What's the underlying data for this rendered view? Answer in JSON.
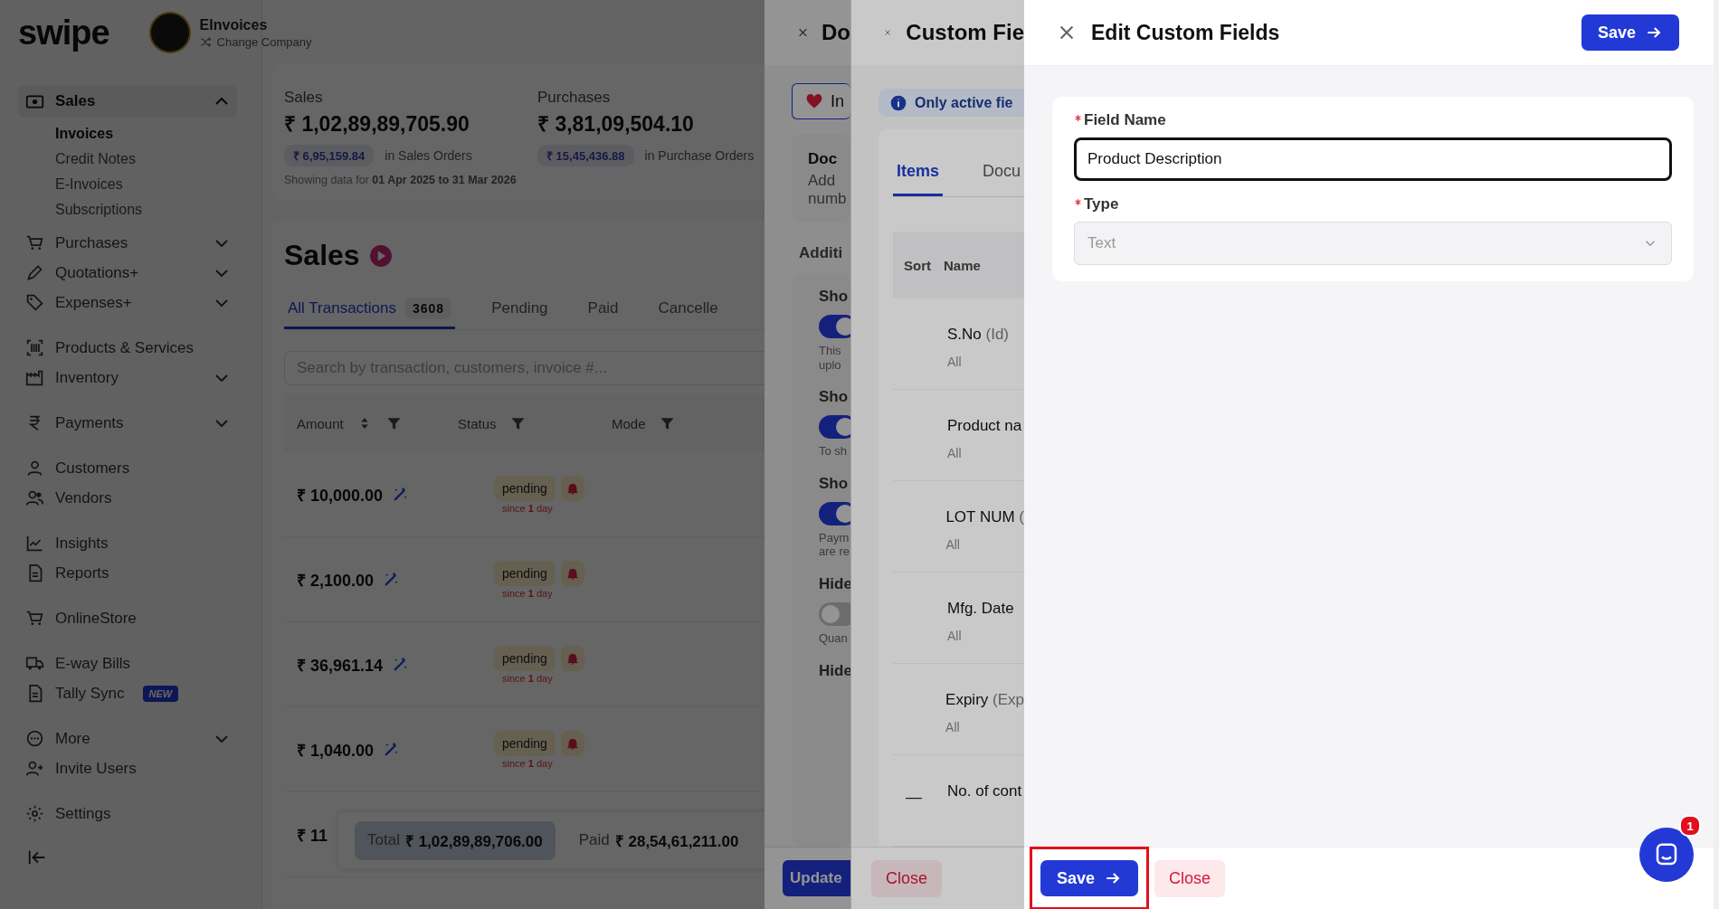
{
  "sidebar": {
    "logo": "swipe",
    "company": {
      "name": "EInvoices",
      "action": "Change Company"
    },
    "sections": [
      {
        "items": [
          {
            "label": "Sales",
            "kind": "group",
            "selected": true,
            "expanded": true,
            "children": [
              {
                "label": "Invoices",
                "selected": true
              },
              {
                "label": "Credit Notes",
                "selected": false
              },
              {
                "label": "E-Invoices",
                "selected": false
              },
              {
                "label": "Subscriptions",
                "selected": false
              }
            ]
          },
          {
            "label": "Purchases",
            "kind": "group",
            "expanded": false
          },
          {
            "label": "Quotations+",
            "kind": "group",
            "expanded": false
          },
          {
            "label": "Expenses+",
            "kind": "group",
            "expanded": false
          }
        ]
      },
      {
        "items": [
          {
            "label": "Products & Services",
            "kind": "link"
          },
          {
            "label": "Inventory",
            "kind": "group",
            "expanded": false
          }
        ]
      },
      {
        "items": [
          {
            "label": "Payments",
            "kind": "group",
            "expanded": false
          }
        ]
      },
      {
        "items": [
          {
            "label": "Customers",
            "kind": "link"
          },
          {
            "label": "Vendors",
            "kind": "link"
          }
        ]
      },
      {
        "items": [
          {
            "label": "Insights",
            "kind": "link"
          },
          {
            "label": "Reports",
            "kind": "link"
          }
        ]
      },
      {
        "items": [
          {
            "label": "OnlineStore",
            "kind": "link"
          }
        ]
      },
      {
        "items": [
          {
            "label": "E-way Bills",
            "kind": "link"
          },
          {
            "label": "Tally Sync",
            "kind": "link",
            "badge": "NEW"
          }
        ]
      },
      {
        "items": [
          {
            "label": "More",
            "kind": "group",
            "expanded": false
          },
          {
            "label": "Invite Users",
            "kind": "link"
          }
        ]
      },
      {
        "items": [
          {
            "label": "Settings",
            "kind": "link"
          }
        ]
      }
    ]
  },
  "sales_page": {
    "stats": [
      {
        "label": "Sales",
        "amount": "₹ 1,02,89,89,705.90",
        "order_amount": "₹ 6,95,159.84",
        "order_label": "in Sales Orders"
      },
      {
        "label": "Purchases",
        "amount": "₹ 3,81,09,504.10",
        "order_amount": "₹ 15,45,436.88",
        "order_label": "in Purchase Orders"
      }
    ],
    "range_note": "Showing data for **01 Apr 2025 to 31 Mar 2026**",
    "title": "Sales",
    "tabs": [
      {
        "label": "All Transactions",
        "count": "3608",
        "selected": true
      },
      {
        "label": "Pending",
        "selected": false
      },
      {
        "label": "Paid",
        "selected": false
      },
      {
        "label": "Cancelle",
        "selected": false
      }
    ],
    "search": {
      "placeholder": "Search by transaction, customers, invoice #..."
    },
    "columns": [
      {
        "label": "Amount",
        "sortable": true
      },
      {
        "label": "Status",
        "sortable": false
      },
      {
        "label": "Mode",
        "sortable": false
      }
    ],
    "rows": [
      {
        "amount": "₹ 10,000.00",
        "status": "pending",
        "since": "since **1** day"
      },
      {
        "amount": "₹ 2,100.00",
        "status": "pending",
        "since": "since **1** day"
      },
      {
        "amount": "₹ 36,961.14",
        "status": "pending",
        "since": "since **1** day"
      },
      {
        "amount": "₹ 1,040.00",
        "status": "pending",
        "since": "since **1** day"
      },
      {
        "amount": "₹ 11"
      }
    ],
    "totals": [
      {
        "label": "Total",
        "value": "₹ 1,02,89,89,706.00",
        "selected": true
      },
      {
        "label": "Paid",
        "value": "₹ 28,54,61,211.00",
        "selected": false
      }
    ]
  },
  "document_drawer": {
    "title": "Do",
    "top_button": "In",
    "card": {
      "title": "Doc",
      "lines": [
        "Add",
        "numb"
      ]
    },
    "section": "Additi",
    "settings": [
      {
        "label": "Sho",
        "on": true,
        "note": [
          "This",
          "uplo"
        ]
      },
      {
        "label": "Sho",
        "on": true,
        "note": [
          "To sh"
        ]
      },
      {
        "label": "Sho",
        "on": true,
        "note": [
          "Paym",
          "are re"
        ]
      },
      {
        "label": "Hide",
        "on": false,
        "note": [
          "Quan"
        ]
      },
      {
        "label": "Hide"
      }
    ],
    "footer_button": "Update"
  },
  "custom_fields_drawer": {
    "title": "Custom Fie",
    "info": "Only active fie",
    "tabs": [
      {
        "label": "Items",
        "selected": true
      },
      {
        "label": "Docu",
        "selected": false
      }
    ],
    "columns": [
      "Sort",
      "Name"
    ],
    "rows": [
      {
        "name": "S.No",
        "hint": "(Id)",
        "scope": "All"
      },
      {
        "name": "Product na",
        "scope": "All"
      },
      {
        "name": "LOT NUM",
        "hint": "(",
        "scope": "All"
      },
      {
        "name": "Mfg. Date",
        "scope": "All"
      },
      {
        "name": "Expiry",
        "hint": "(Exp",
        "scope": "All"
      },
      {
        "name": "No. of cont",
        "sort": "—"
      }
    ],
    "footer_button": "Close"
  },
  "edit_drawer": {
    "title": "Edit Custom Fields",
    "header_button": "Save",
    "fields": [
      {
        "kind": "text",
        "label": "Field Name",
        "required": true,
        "value": "Product Description",
        "focused": true
      },
      {
        "kind": "select",
        "label": "Type",
        "required": true,
        "value": "Text",
        "disabled": true
      }
    ],
    "footer": {
      "save": "Save",
      "close": "Close",
      "highlighted": true
    },
    "chat_badge": "1"
  }
}
